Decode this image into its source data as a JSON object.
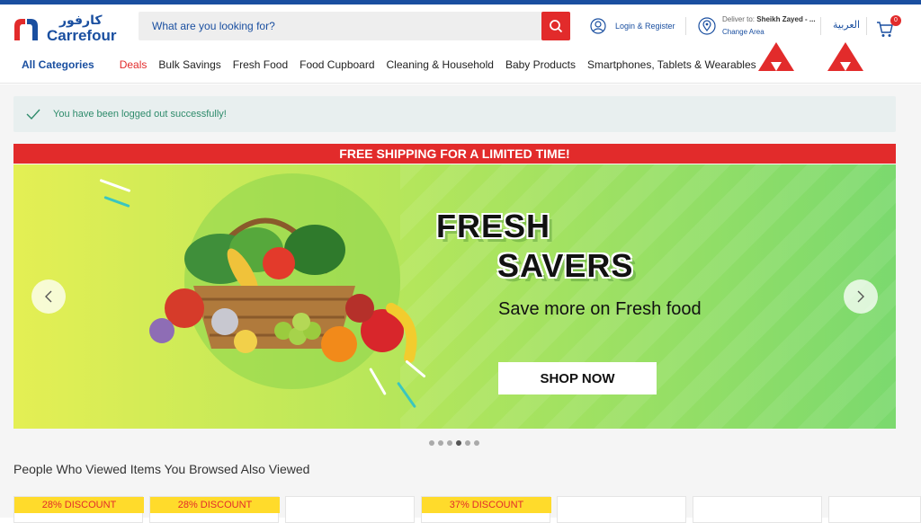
{
  "header": {
    "logo_text": "Carrefour",
    "logo_arabic": "كارفور",
    "search_placeholder": "What are you looking for?",
    "login_label": "Login & Register",
    "deliver_prefix": "Deliver to:",
    "deliver_location": "Sheikh Zayed - ...",
    "change_area_label": "Change Area",
    "language_label": "العربية",
    "cart_count": "0"
  },
  "nav": {
    "all_categories": "All Categories",
    "items": [
      "Deals",
      "Bulk Savings",
      "Fresh Food",
      "Food Cupboard",
      "Cleaning & Household",
      "Baby Products",
      "Smartphones, Tablets & Wearables"
    ]
  },
  "alert": {
    "message": "You have been logged out successfully!"
  },
  "promo": {
    "text": "FREE SHIPPING FOR A LIMITED TIME!"
  },
  "banner": {
    "title_line1": "FRESH",
    "title_line2": "SAVERS",
    "subtitle": "Save more on Fresh food",
    "cta": "SHOP NOW",
    "slide_count": 6,
    "active_slide": 4
  },
  "recommendations": {
    "title": "People Who Viewed Items You Browsed Also Viewed",
    "cards": [
      {
        "badge": "28% DISCOUNT"
      },
      {
        "badge": "28% DISCOUNT"
      },
      {
        "badge": ""
      },
      {
        "badge": "37% DISCOUNT"
      },
      {
        "badge": ""
      },
      {
        "badge": ""
      },
      {
        "badge": ""
      }
    ]
  },
  "colors": {
    "brand_blue": "#1a4fa0",
    "accent_red": "#e22b2b",
    "discount_yellow": "#ffdb2b"
  }
}
